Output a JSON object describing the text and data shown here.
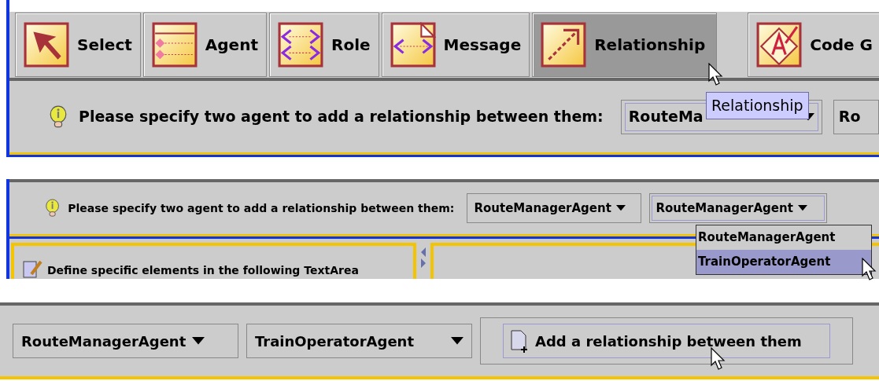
{
  "toolbar": {
    "buttons": [
      {
        "kind": "select",
        "label": "Select",
        "selected": false
      },
      {
        "kind": "agent",
        "label": "Agent",
        "selected": false
      },
      {
        "kind": "role",
        "label": "Role",
        "selected": false
      },
      {
        "kind": "message",
        "label": "Message",
        "selected": false
      },
      {
        "kind": "relationship",
        "label": "Relationship",
        "selected": true
      },
      {
        "kind": "code",
        "label": "Code G",
        "selected": false
      }
    ],
    "tooltip": "Relationship"
  },
  "prompt_1": {
    "message": "Please specify two agent to add a relationship between them:",
    "combo_1": "RouteMa",
    "combo_2": "Ro"
  },
  "prompt_2": {
    "message": "Please specify two agent to add a relationship between them:",
    "combo_1": "RouteManagerAgent",
    "combo_2": "RouteManagerAgent",
    "dropdown": [
      {
        "label": "RouteManagerAgent",
        "selected": false
      },
      {
        "label": "TrainOperatorAgent",
        "selected": true
      }
    ],
    "editor_hint": "Define specific elements in the following TextArea"
  },
  "prompt_3": {
    "combo_1": "RouteManagerAgent",
    "combo_2": "TrainOperatorAgent",
    "add_button": "Add a relationship between them"
  }
}
